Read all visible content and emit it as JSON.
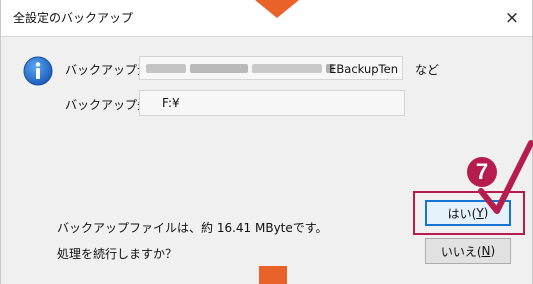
{
  "dialog": {
    "title": "全設定のバックアップ",
    "close_symbol": "×",
    "source_label": "バックアップ元",
    "source_value_suffix": "EBackupTen",
    "source_trailing": "など",
    "dest_label": "バックアップ先",
    "dest_value": "F:¥",
    "size_message": "バックアップファイルは、約 16.41 MByteです。",
    "confirm_message": "処理を続行しますか？",
    "yes_label_prefix": "はい(",
    "yes_mnemonic": "Y",
    "yes_label_suffix": ")",
    "no_label_prefix": "いいえ(",
    "no_mnemonic": "N",
    "no_label_suffix": ")"
  },
  "annotation": {
    "step_number": "7",
    "accent_color": "#b71c4f",
    "pointer_color": "#e8622a"
  },
  "icons": {
    "info": "info-icon",
    "close": "close-icon",
    "check": "check-mark-icon"
  }
}
